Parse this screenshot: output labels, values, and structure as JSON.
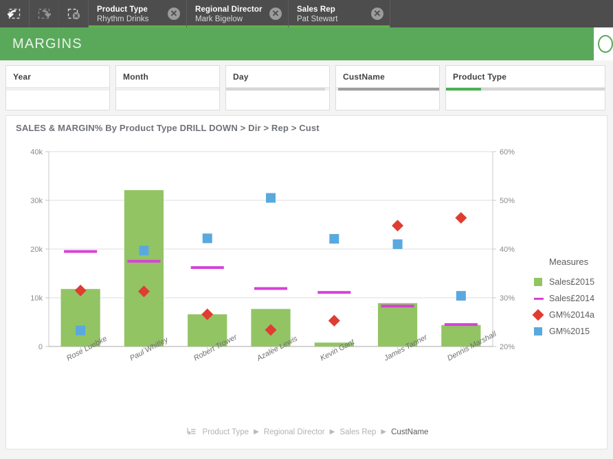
{
  "selection_bar": {
    "tools": [
      {
        "name": "step-back-icon",
        "label": "Step back",
        "enabled": true
      },
      {
        "name": "step-forward-icon",
        "label": "Step forward",
        "enabled": false
      },
      {
        "name": "clear-all-selections-icon",
        "label": "Clear all selections",
        "enabled": true
      }
    ],
    "selections": [
      {
        "field": "Product Type",
        "value": "Rhythm Drinks",
        "clear_label": "✕"
      },
      {
        "field": "Regional Director",
        "value": "Mark Bigelow",
        "clear_label": "✕"
      },
      {
        "field": "Sales Rep",
        "value": "Pat Stewart",
        "clear_label": "✕"
      }
    ]
  },
  "header": {
    "title": "MARGINS",
    "accent_color": "#5aa95b"
  },
  "filters": [
    {
      "label": "Year",
      "selected_fraction": 0.0,
      "selection_color": "#9e9e9e",
      "scroll_fraction": 0.0
    },
    {
      "label": "Month",
      "selected_fraction": 0.0,
      "selection_color": "#9e9e9e",
      "scroll_fraction": 0.0
    },
    {
      "label": "Day",
      "selected_fraction": 0.0,
      "selection_color": "#9e9e9e",
      "scroll_fraction": 0.0
    },
    {
      "label": "CustName",
      "selected_fraction": 1.0,
      "selection_color": "#9e9e9e",
      "scroll_fraction": 0.0
    },
    {
      "label": "Product Type",
      "selected_fraction": 0.22,
      "selection_color": "#4caf50",
      "scroll_fraction": 0.0
    }
  ],
  "chart_data": {
    "type": "bar",
    "title": "SALES & MARGIN% By Product Type DRILL DOWN > Dir > Rep > Cust",
    "xlabel": "",
    "ylabel": "",
    "categories": [
      "Rose Luebke",
      "Paul Whitley",
      "Robert Trower",
      "Azalee Lewis",
      "Kevin Gant",
      "James Tanner",
      "Dennis Marshall"
    ],
    "ylim": [
      0,
      40000
    ],
    "yticks": [
      0,
      10000,
      20000,
      30000,
      40000
    ],
    "ytick_labels": [
      "0",
      "10k",
      "20k",
      "30k",
      "40k"
    ],
    "y2lim": [
      20,
      60
    ],
    "y2ticks": [
      20,
      30,
      40,
      50,
      60
    ],
    "y2tick_labels": [
      "20%",
      "30%",
      "40%",
      "50%",
      "60%"
    ],
    "grid": true,
    "legend_position": "right",
    "legend_title": "Measures",
    "series": [
      {
        "name": "Sales£2015",
        "type": "bar",
        "axis": "left",
        "color": "#92c464",
        "values": [
          11800,
          32100,
          6600,
          7700,
          800,
          8900,
          4400
        ]
      },
      {
        "name": "Sales£2014",
        "type": "marker-line",
        "axis": "left",
        "color": "#d940d9",
        "values": [
          19500,
          17500,
          16200,
          11900,
          11100,
          8300,
          4500
        ]
      },
      {
        "name": "GM%2014a",
        "type": "diamond",
        "axis": "right",
        "color": "#e03c31",
        "values": [
          31.5,
          31.3,
          26.6,
          23.4,
          25.3,
          44.8,
          46.4
        ]
      },
      {
        "name": "GM%2015",
        "type": "square",
        "axis": "right",
        "color": "#59a9df",
        "values": [
          23.3,
          39.7,
          42.2,
          50.5,
          42.1,
          41.0,
          30.4
        ]
      }
    ]
  },
  "drill_breadcrumb": {
    "icon_name": "drill-down-icon",
    "crumbs": [
      "Product Type",
      "Regional Director",
      "Sales Rep",
      "CustName"
    ],
    "active_index": 3,
    "separator": "▶"
  }
}
